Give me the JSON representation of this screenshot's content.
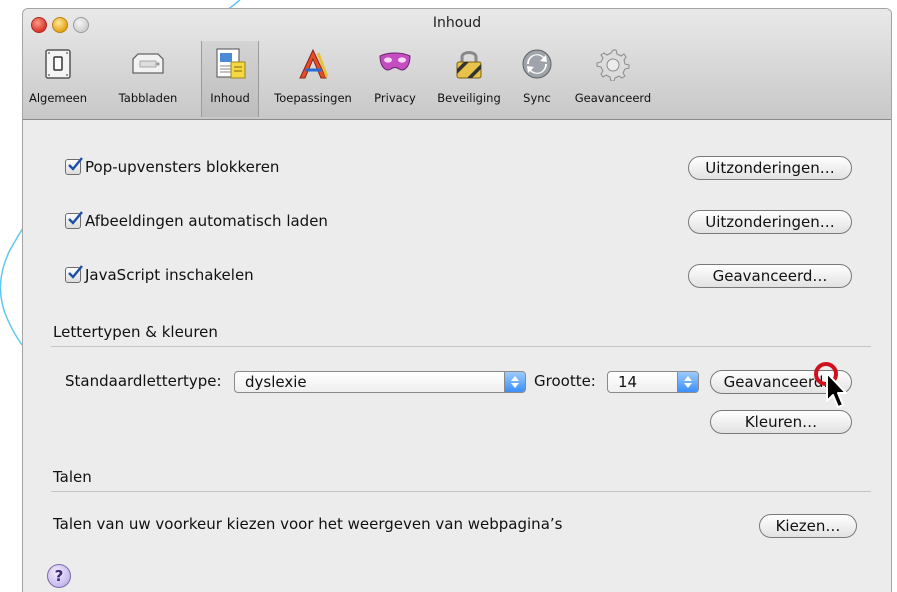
{
  "window": {
    "title": "Inhoud"
  },
  "tabs": [
    {
      "label": "Algemeen",
      "icon": "switch-icon"
    },
    {
      "label": "Tabbladen",
      "icon": "tabs-icon"
    },
    {
      "label": "Inhoud",
      "icon": "content-icon",
      "active": true
    },
    {
      "label": "Toepassingen",
      "icon": "applications-icon"
    },
    {
      "label": "Privacy",
      "icon": "mask-icon"
    },
    {
      "label": "Beveiliging",
      "icon": "lock-icon"
    },
    {
      "label": "Sync",
      "icon": "sync-icon"
    },
    {
      "label": "Geavanceerd",
      "icon": "gear-icon"
    }
  ],
  "options": [
    {
      "label": "Pop-upvensters blokkeren",
      "checked": true,
      "button": "Uitzonderingen…"
    },
    {
      "label": "Afbeeldingen automatisch laden",
      "checked": true,
      "button": "Uitzonderingen…"
    },
    {
      "label": "JavaScript inschakelen",
      "checked": true,
      "button": "Geavanceerd…"
    }
  ],
  "fonts": {
    "section_title": "Lettertypen & kleuren",
    "default_font_label": "Standaardlettertype:",
    "default_font_value": "dyslexie",
    "size_label": "Grootte:",
    "size_value": "14",
    "advanced_button": "Geavanceerd…",
    "colors_button": "Kleuren…"
  },
  "languages": {
    "section_title": "Talen",
    "description": "Talen van uw voorkeur kiezen voor het weergeven van webpagina’s",
    "choose_button": "Kiezen…"
  },
  "help": {
    "label": "?"
  },
  "colors": {
    "accent_blue": "#3e8ef7",
    "highlight_red": "#d0101e",
    "decor_line": "#5ec8f0"
  }
}
